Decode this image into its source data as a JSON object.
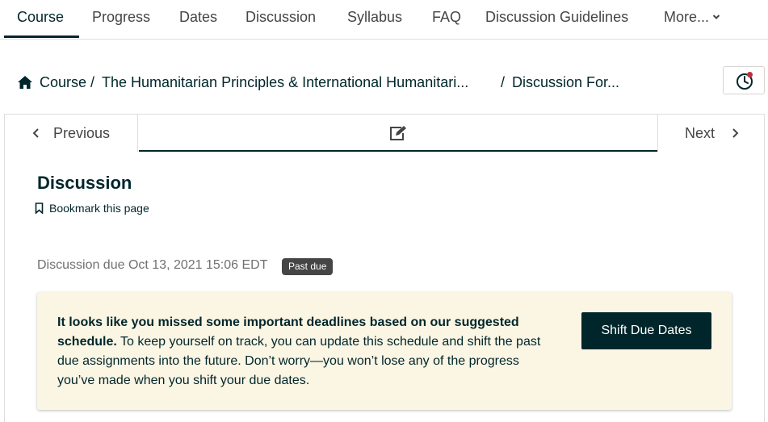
{
  "tabs": [
    {
      "label": "Course",
      "active": true
    },
    {
      "label": "Progress"
    },
    {
      "label": "Dates"
    },
    {
      "label": "Discussion"
    },
    {
      "label": "Syllabus"
    },
    {
      "label": "FAQ"
    },
    {
      "label": "Discussion Guidelines"
    },
    {
      "label": "More..."
    }
  ],
  "breadcrumb": {
    "home_icon": "home-icon",
    "items": [
      "Course",
      "The Humanitarian Principles & International Humanitari...",
      "Discussion For..."
    ],
    "separator": "/"
  },
  "clock_button": {
    "icon": "clock-icon",
    "has_notification_dot": true,
    "dot_color": "#c32d3a"
  },
  "sequence_nav": {
    "previous_label": "Previous",
    "next_label": "Next",
    "unit_icon": "edit-icon"
  },
  "unit": {
    "title": "Discussion",
    "bookmark_label": "Bookmark this page"
  },
  "due": {
    "text": "Discussion due Oct 13, 2021 15:06 EDT",
    "badge": "Past due"
  },
  "alert": {
    "bold_text": "It looks like you missed some important deadlines based on our suggested schedule.",
    "body_text": " To keep yourself on track, you can update this schedule and shift the past due assignments into the future. Don’t worry—you won’t lose any of the progress you’ve made when you shift your due dates.",
    "button_label": "Shift Due Dates",
    "background": "#fbf5e4"
  },
  "colors": {
    "primary": "#00262b",
    "text": "#454545",
    "muted": "#707070",
    "border": "#e1dddb"
  }
}
